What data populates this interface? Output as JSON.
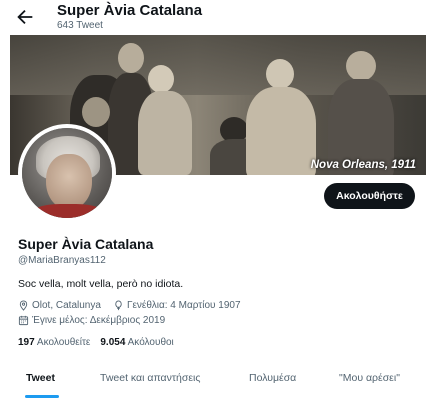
{
  "header": {
    "name": "Super Àvia Catalana",
    "tweet_count": "643 Tweet"
  },
  "banner": {
    "caption": "Nova Orleans, 1911"
  },
  "actions": {
    "follow_label": "Ακολουθήστε"
  },
  "profile": {
    "name": "Super Àvia Catalana",
    "handle": "@MariaBranyas112",
    "bio": "Soc vella, molt vella, però no idiota.",
    "location": "Olot, Catalunya",
    "birthday": "Γενέθλια: 4 Μαρτίου 1907",
    "joined": "Έγινε μέλος: Δεκέμβριος 2019"
  },
  "stats": {
    "following_count": "197",
    "following_label": "Ακολουθείτε",
    "followers_count": "9.054",
    "followers_label": "Ακόλουθοι"
  },
  "tabs": [
    {
      "label": "Tweet",
      "active": true
    },
    {
      "label": "Tweet και απαντήσεις",
      "active": false
    },
    {
      "label": "Πολυμέσα",
      "active": false
    },
    {
      "label": "\"Μου αρέσει\"",
      "active": false
    }
  ],
  "colors": {
    "accent": "#1d9bf0",
    "text": "#0f1419",
    "muted": "#536471"
  },
  "icons": {
    "back": "arrow-left-icon",
    "location": "location-pin-icon",
    "birthday": "balloon-icon",
    "joined": "calendar-icon"
  }
}
